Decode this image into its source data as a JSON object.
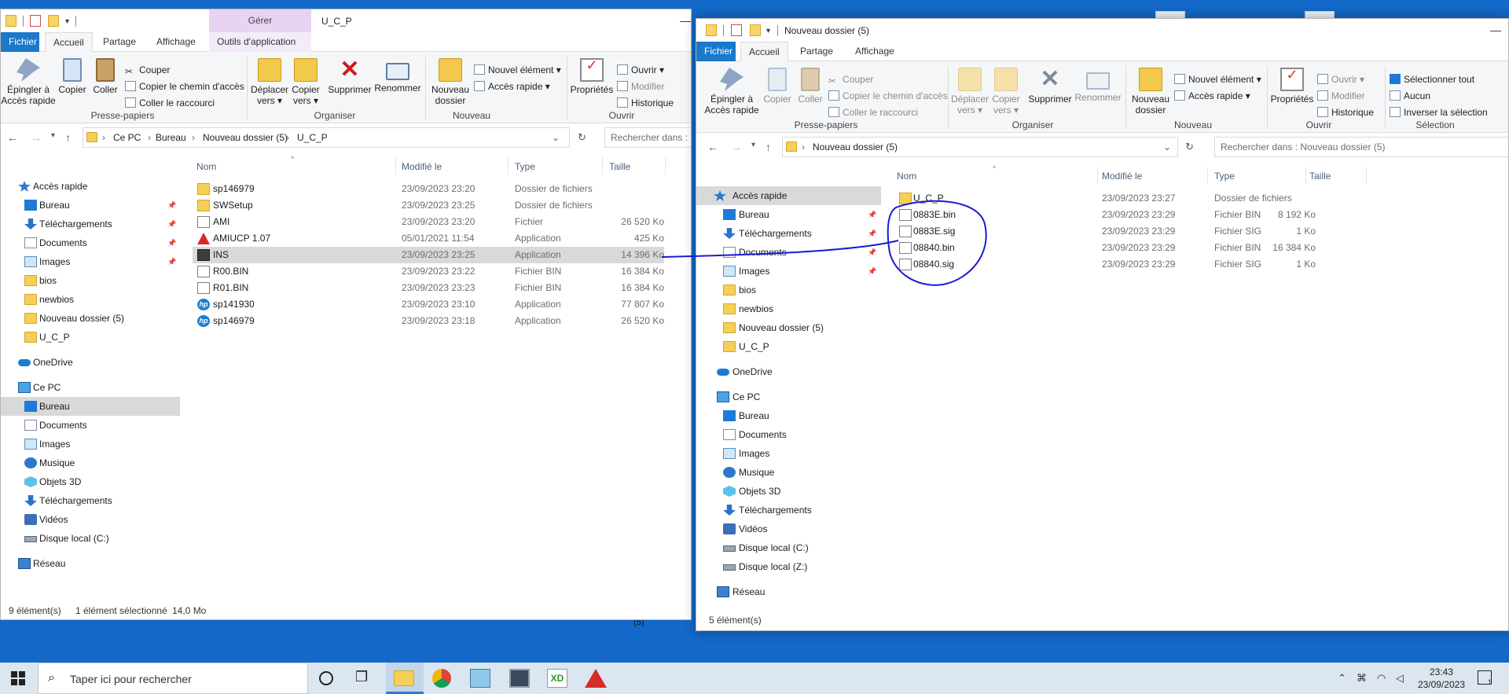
{
  "desktop": {
    "stray_text": "(5)"
  },
  "win1": {
    "manage_tab": "Gérer",
    "title": "U_C_P",
    "tabs": [
      {
        "label": "Fichier"
      },
      {
        "label": "Accueil"
      },
      {
        "label": "Partage"
      },
      {
        "label": "Affichage"
      },
      {
        "label": "Outils d'application"
      }
    ],
    "ribbon": {
      "pin": "Épingler à\nAccès rapide",
      "copy": "Copier",
      "paste": "Coller",
      "cut": "Couper",
      "copy_path": "Copier le chemin d'accès",
      "paste_shortcut": "Coller le raccourci",
      "group_clipboard": "Presse-papiers",
      "move_to": "Déplacer\nvers ▾",
      "copy_to": "Copier\nvers ▾",
      "delete": "Supprimer",
      "rename": "Renommer",
      "group_organize": "Organiser",
      "new_folder": "Nouveau\ndossier",
      "new_item": "Nouvel élément ▾",
      "easy_access": "Accès rapide ▾",
      "group_new": "Nouveau",
      "properties": "Propriétés",
      "open": "Ouvrir ▾",
      "edit": "Modifier",
      "history": "Historique",
      "group_open": "Ouvrir"
    },
    "breadcrumb": [
      "Ce PC",
      "Bureau",
      "Nouveau dossier (5)",
      "U_C_P"
    ],
    "search_placeholder": "Rechercher dans : U_C_P",
    "nav": [
      {
        "label": "Accès rapide"
      },
      {
        "label": "Bureau"
      },
      {
        "label": "Téléchargements"
      },
      {
        "label": "Documents"
      },
      {
        "label": "Images"
      },
      {
        "label": "bios"
      },
      {
        "label": "newbios"
      },
      {
        "label": "Nouveau dossier (5)"
      },
      {
        "label": "U_C_P"
      },
      {
        "label": "OneDrive"
      },
      {
        "label": "Ce PC"
      },
      {
        "label": "Bureau"
      },
      {
        "label": "Documents"
      },
      {
        "label": "Images"
      },
      {
        "label": "Musique"
      },
      {
        "label": "Objets 3D"
      },
      {
        "label": "Téléchargements"
      },
      {
        "label": "Vidéos"
      },
      {
        "label": "Disque local (C:)"
      },
      {
        "label": "Réseau"
      }
    ],
    "columns": [
      "Nom",
      "Modifié le",
      "Type",
      "Taille"
    ],
    "files": [
      {
        "name": "sp146979",
        "modified": "23/09/2023 23:20",
        "type": "Dossier de fichiers",
        "size": "",
        "icon": "folder-icon"
      },
      {
        "name": "SWSetup",
        "modified": "23/09/2023 23:25",
        "type": "Dossier de fichiers",
        "size": "",
        "icon": "folder-icon"
      },
      {
        "name": "AMI",
        "modified": "23/09/2023 23:20",
        "type": "Fichier",
        "size": "26 520 Ko",
        "icon": "file-icon"
      },
      {
        "name": "AMIUCP 1.07",
        "modified": "05/01/2021 11:54",
        "type": "Application",
        "size": "425 Ko",
        "icon": "ami-app-icon"
      },
      {
        "name": "INS",
        "modified": "23/09/2023 23:25",
        "type": "Application",
        "size": "14 396 Ko",
        "icon": "ins-app-icon"
      },
      {
        "name": "R00.BIN",
        "modified": "23/09/2023 23:22",
        "type": "Fichier BIN",
        "size": "16 384 Ko",
        "icon": "file-icon"
      },
      {
        "name": "R01.BIN",
        "modified": "23/09/2023 23:23",
        "type": "Fichier BIN",
        "size": "16 384 Ko",
        "icon": "file-icon"
      },
      {
        "name": "sp141930",
        "modified": "23/09/2023 23:10",
        "type": "Application",
        "size": "77 807 Ko",
        "icon": "hp-icon"
      },
      {
        "name": "sp146979",
        "modified": "23/09/2023 23:18",
        "type": "Application",
        "size": "26 520 Ko",
        "icon": "hp-icon"
      }
    ],
    "status": {
      "count": "9 élément(s)",
      "selected": "1 élément sélectionné",
      "size": "14,0 Mo"
    }
  },
  "win2": {
    "title": "Nouveau dossier (5)",
    "tabs": [
      {
        "label": "Fichier"
      },
      {
        "label": "Accueil"
      },
      {
        "label": "Partage"
      },
      {
        "label": "Affichage"
      }
    ],
    "ribbon": {
      "pin": "Épingler à\nAccès rapide",
      "copy": "Copier",
      "paste": "Coller",
      "cut": "Couper",
      "copy_path": "Copier le chemin d'accès",
      "paste_shortcut": "Coller le raccourci",
      "group_clipboard": "Presse-papiers",
      "move_to": "Déplacer\nvers ▾",
      "copy_to": "Copier\nvers ▾",
      "delete": "Supprimer",
      "rename": "Renommer",
      "group_organize": "Organiser",
      "new_folder": "Nouveau\ndossier",
      "new_item": "Nouvel élément ▾",
      "easy_access": "Accès rapide ▾",
      "group_new": "Nouveau",
      "properties": "Propriétés",
      "open": "Ouvrir ▾",
      "edit": "Modifier",
      "history": "Historique",
      "group_open": "Ouvrir",
      "select_all": "Sélectionner tout",
      "select_none": "Aucun",
      "invert_selection": "Inverser la sélection",
      "group_select": "Sélection"
    },
    "breadcrumb": [
      "Nouveau dossier (5)"
    ],
    "search_placeholder": "Rechercher dans : Nouveau dossier (5)",
    "nav": [
      {
        "label": "Accès rapide"
      },
      {
        "label": "Bureau"
      },
      {
        "label": "Téléchargements"
      },
      {
        "label": "Documents"
      },
      {
        "label": "Images"
      },
      {
        "label": "bios"
      },
      {
        "label": "newbios"
      },
      {
        "label": "Nouveau dossier (5)"
      },
      {
        "label": "U_C_P"
      },
      {
        "label": "OneDrive"
      },
      {
        "label": "Ce PC"
      },
      {
        "label": "Bureau"
      },
      {
        "label": "Documents"
      },
      {
        "label": "Images"
      },
      {
        "label": "Musique"
      },
      {
        "label": "Objets 3D"
      },
      {
        "label": "Téléchargements"
      },
      {
        "label": "Vidéos"
      },
      {
        "label": "Disque local (C:)"
      },
      {
        "label": "Disque local (Z:)"
      },
      {
        "label": "Réseau"
      }
    ],
    "columns": [
      "Nom",
      "Modifié le",
      "Type",
      "Taille"
    ],
    "files": [
      {
        "name": "U_C_P",
        "modified": "23/09/2023 23:27",
        "type": "Dossier de fichiers",
        "size": "",
        "icon": "folder-icon"
      },
      {
        "name": "0883E.bin",
        "modified": "23/09/2023 23:29",
        "type": "Fichier BIN",
        "size": "8 192 Ko",
        "icon": "file-icon"
      },
      {
        "name": "0883E.sig",
        "modified": "23/09/2023 23:29",
        "type": "Fichier SIG",
        "size": "1 Ko",
        "icon": "file-icon"
      },
      {
        "name": "08840.bin",
        "modified": "23/09/2023 23:29",
        "type": "Fichier BIN",
        "size": "16 384 Ko",
        "icon": "file-icon"
      },
      {
        "name": "08840.sig",
        "modified": "23/09/2023 23:29",
        "type": "Fichier SIG",
        "size": "1 Ko",
        "icon": "file-icon"
      }
    ],
    "status": {
      "count": "5 élément(s)"
    }
  },
  "taskbar": {
    "search_placeholder": "Taper ici pour rechercher",
    "time": "23:43",
    "date": "23/09/2023",
    "notification_count": "1",
    "pinned_apps": [
      "task-view-icon",
      "file-explorer-icon",
      "chrome-icon",
      "notepad-icon",
      "cpu-icon",
      "xd-icon",
      "ami-icon"
    ]
  },
  "colors": {
    "accent": "#1979ca",
    "annotation": "#1a1adb",
    "desktop": "#1368c8"
  }
}
